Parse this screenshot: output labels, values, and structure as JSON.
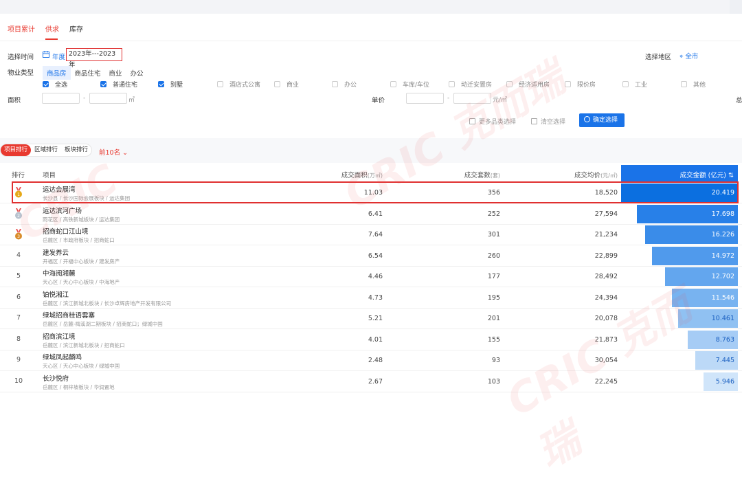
{
  "tabs": [
    "项目累计",
    "供求",
    "库存"
  ],
  "filters": {
    "time_label": "选择时间",
    "year_label": "年度",
    "date_range": "2023年---2023年",
    "region_label": "选择地区",
    "region_value": "全市",
    "property_type_label": "物业类型",
    "property_types": [
      "商品房",
      "商品住宅",
      "商业",
      "办公"
    ],
    "checkboxes": [
      {
        "label": "全选",
        "checked": true
      },
      {
        "label": "普通住宅",
        "checked": true
      },
      {
        "label": "别墅",
        "checked": true
      },
      {
        "label": "酒店式公寓",
        "checked": false
      },
      {
        "label": "商业",
        "checked": false
      },
      {
        "label": "办公",
        "checked": false
      },
      {
        "label": "车库/车位",
        "checked": false
      },
      {
        "label": "动迁安置房",
        "checked": false
      },
      {
        "label": "经济适用房",
        "checked": false
      },
      {
        "label": "限价房",
        "checked": false
      },
      {
        "label": "工业",
        "checked": false
      },
      {
        "label": "其他",
        "checked": false
      }
    ],
    "area_label": "面积",
    "dash": "-",
    "area_unit": "㎡",
    "price_label": "单价",
    "price_unit": "元/㎡",
    "total_label": "总",
    "more_types": "更多品类选择",
    "clear": "清空选择",
    "confirm": "确定选择"
  },
  "ranking": {
    "modes": [
      "项目排行",
      "区域排行",
      "板块排行"
    ],
    "top_label": "前10名",
    "columns": {
      "rank": "排行",
      "project": "项目",
      "area": "成交面积",
      "area_unit": "(万㎡)",
      "sets": "成交套数",
      "sets_unit": "(套)",
      "price": "成交均价",
      "price_unit": "(元/㎡)",
      "amount": "成交金额 (亿元)"
    }
  },
  "rows": [
    {
      "rank": "1",
      "name": "运达会展湾",
      "sub": "长沙县 / 长沙国际会展板块 / 运达集团",
      "area": "11.03",
      "sets": "356",
      "price": "18,520",
      "amount": "20.419",
      "amount_value": 20.419
    },
    {
      "rank": "2",
      "name": "运达滨河广场",
      "sub": "雨花区 / 高铁新城板块 / 运达集团",
      "area": "6.41",
      "sets": "252",
      "price": "27,594",
      "amount": "17.698",
      "amount_value": 17.698
    },
    {
      "rank": "3",
      "name": "招商蛇口江山境",
      "sub": "岳麓区 / 市政府板块 / 招商蛇口",
      "area": "7.64",
      "sets": "301",
      "price": "21,234",
      "amount": "16.226",
      "amount_value": 16.226
    },
    {
      "rank": "4",
      "name": "建发养云",
      "sub": "开福区 / 开福中心板块 / 建发房产",
      "area": "6.54",
      "sets": "260",
      "price": "22,899",
      "amount": "14.972",
      "amount_value": 14.972
    },
    {
      "rank": "5",
      "name": "中海阅湘麓",
      "sub": "天心区 / 天心中心板块 / 中海地产",
      "area": "4.46",
      "sets": "177",
      "price": "28,492",
      "amount": "12.702",
      "amount_value": 12.702
    },
    {
      "rank": "6",
      "name": "铂悦湘江",
      "sub": "岳麓区 / 滨江新城北板块 / 长沙卓辉房地产开发有限公司",
      "area": "4.73",
      "sets": "195",
      "price": "24,394",
      "amount": "11.546",
      "amount_value": 11.546
    },
    {
      "rank": "7",
      "name": "绿城招商桂语雲塞",
      "sub": "岳麓区 / 岳麓-梅溪湖二期板块 / 招商蛇口；绿城中国",
      "area": "5.21",
      "sets": "201",
      "price": "20,078",
      "amount": "10.461",
      "amount_value": 10.461
    },
    {
      "rank": "8",
      "name": "招商滨江境",
      "sub": "岳麓区 / 滨江新城北板块 / 招商蛇口",
      "area": "4.01",
      "sets": "155",
      "price": "21,873",
      "amount": "8.763",
      "amount_value": 8.763
    },
    {
      "rank": "9",
      "name": "绿城凤起麟鸣",
      "sub": "天心区 / 天心中心板块 / 绿城中国",
      "area": "2.48",
      "sets": "93",
      "price": "30,054",
      "amount": "7.445",
      "amount_value": 7.445
    },
    {
      "rank": "10",
      "name": "长沙悦府",
      "sub": "岳麓区 / 桐梓坡板块 / 华润置地",
      "area": "2.67",
      "sets": "103",
      "price": "22,245",
      "amount": "5.946",
      "amount_value": 5.946
    }
  ],
  "bar_colors": [
    "#0b6fe0",
    "#2880e8",
    "#3a8ce9",
    "#509aec",
    "#63a6ee",
    "#78b3f0",
    "#90c1f2",
    "#a6ccf5",
    "#bcd9f7",
    "#d0e5fa"
  ],
  "watermark": "CRIC 克而瑞"
}
